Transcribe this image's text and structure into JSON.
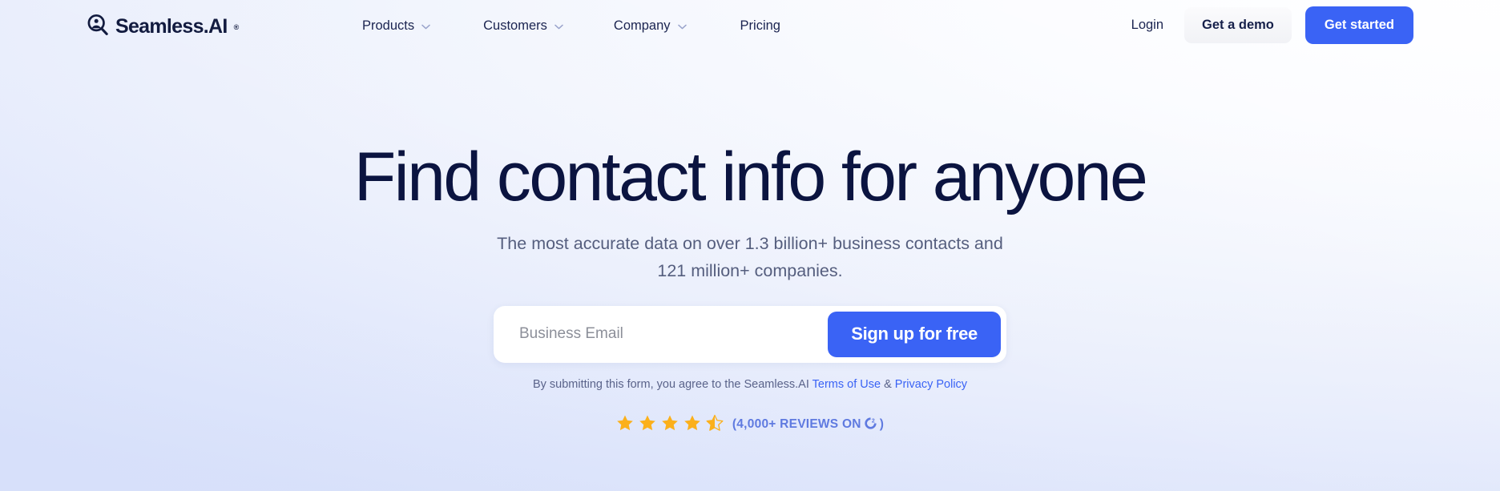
{
  "brand": {
    "name": "Seamless.AI",
    "trademark": "®",
    "logo_icon": "magnifier-person-icon"
  },
  "nav": {
    "items": [
      {
        "label": "Products",
        "has_dropdown": true,
        "icon": "chevron-down-icon"
      },
      {
        "label": "Customers",
        "has_dropdown": true,
        "icon": "chevron-down-icon"
      },
      {
        "label": "Company",
        "has_dropdown": true,
        "icon": "chevron-down-icon"
      },
      {
        "label": "Pricing",
        "has_dropdown": false,
        "icon": ""
      }
    ],
    "login_label": "Login",
    "demo_label": "Get a demo",
    "started_label": "Get started"
  },
  "hero": {
    "headline": "Find contact info for anyone",
    "subhead_line1": "The most accurate data on over 1.3 billion+ business contacts and",
    "subhead_line2": "121 million+ companies.",
    "form": {
      "email_placeholder": "Business Email",
      "email_value": "",
      "submit_label": "Sign up for free"
    },
    "legal": {
      "prefix": "By submitting this form, you agree to the Seamless.AI ",
      "terms_label": "Terms of Use",
      "separator": " & ",
      "privacy_label": "Privacy Policy"
    },
    "reviews": {
      "star_count": 5,
      "filled_stars": 4,
      "half_stars": 1,
      "rating": 4.5,
      "text_prefix": "(4,000+ REVIEWS ON ",
      "platform": "G2",
      "platform_icon": "g2-logo-icon",
      "text_suffix": ")"
    }
  },
  "colors": {
    "accent_blue": "#3a63f5",
    "navy": "#0b1440",
    "star_gold": "#fbb01b",
    "review_text": "#5f7ae0",
    "muted_text": "#555e7e"
  }
}
